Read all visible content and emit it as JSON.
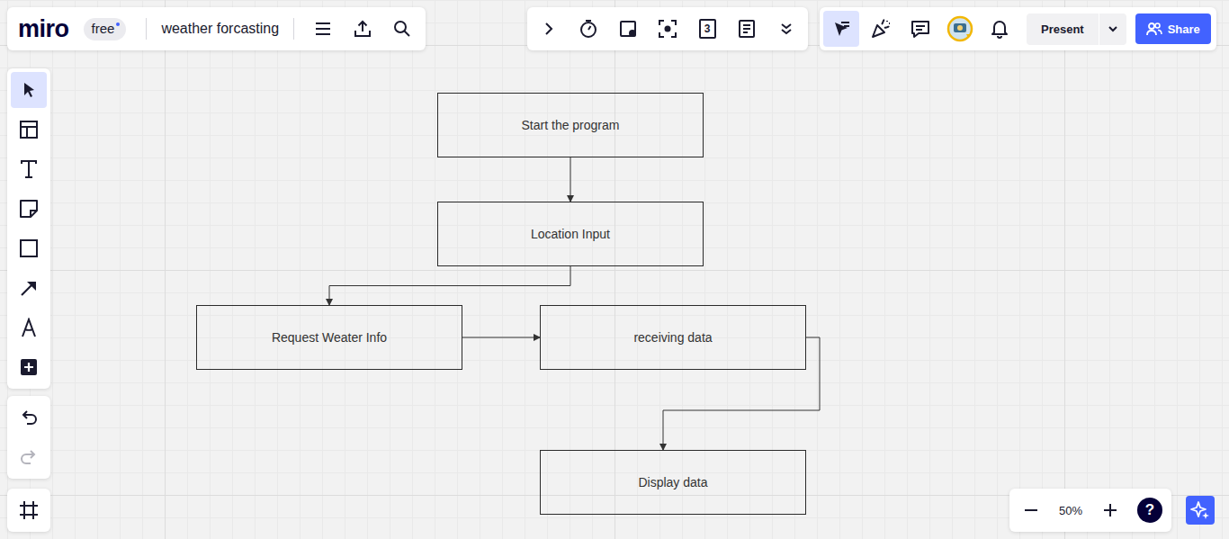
{
  "board": {
    "logo": "miro",
    "plan": "free",
    "title": "weather forcasting"
  },
  "toolbar": {
    "counter": "3"
  },
  "collaboration": {
    "cursor_selected": true,
    "present": "Present",
    "share": "Share"
  },
  "tools": [
    {
      "tool": "select",
      "selected": true
    },
    {
      "tool": "templates",
      "selected": false
    },
    {
      "tool": "text",
      "selected": false
    },
    {
      "tool": "sticky-note",
      "selected": false
    },
    {
      "tool": "shape",
      "selected": false
    },
    {
      "tool": "connector",
      "selected": false
    },
    {
      "tool": "pen",
      "selected": false
    },
    {
      "tool": "more",
      "selected": false
    }
  ],
  "history": {
    "undo_disabled": false,
    "redo_disabled": true
  },
  "zoom": {
    "level": "50%",
    "help": "?"
  },
  "diagram": {
    "nodes": [
      "Start the program",
      "Location Input",
      "Request Weater Info",
      "receiving data",
      "Display data"
    ],
    "edges": [
      {
        "from": "Start the program",
        "to": "Location Input"
      },
      {
        "from": "Location Input",
        "to": "Request Weater Info"
      },
      {
        "from": "Request Weater Info",
        "to": "receiving data"
      },
      {
        "from": "receiving data",
        "to": "Display data"
      }
    ]
  }
}
